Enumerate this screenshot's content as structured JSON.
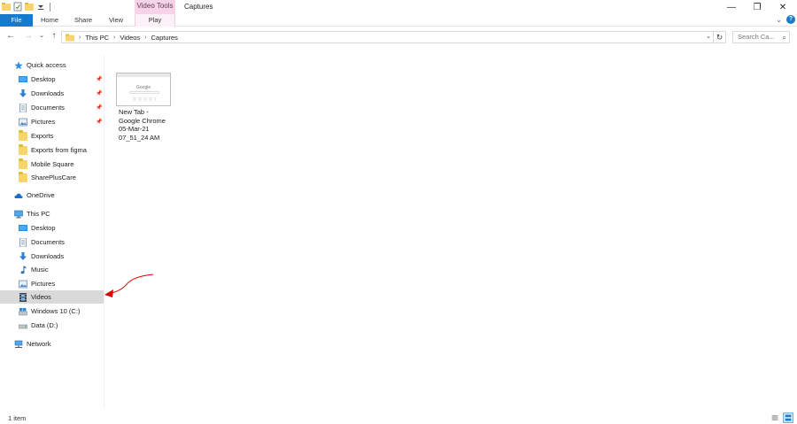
{
  "titlebar": {
    "contextual_tab": "Video Tools",
    "window_title": "Captures",
    "minimize": "—",
    "restore": "❐",
    "close": "✕"
  },
  "ribbon": {
    "tabs": [
      "File",
      "Home",
      "Share",
      "View",
      "Play"
    ],
    "collapse": "⌄",
    "help": "?"
  },
  "address": {
    "back": "←",
    "forward": "→",
    "recent": "⌄",
    "up": "↑",
    "crumbs": [
      "This PC",
      "Videos",
      "Captures"
    ],
    "separator": "›",
    "dropdown": "⌄",
    "refresh": "↻",
    "search_placeholder": "Search Ca...",
    "search_icon": "⌕"
  },
  "nav": {
    "quick_access": "Quick access",
    "quick_items": [
      {
        "label": "Desktop",
        "pinned": true
      },
      {
        "label": "Downloads",
        "pinned": true
      },
      {
        "label": "Documents",
        "pinned": true
      },
      {
        "label": "Pictures",
        "pinned": true
      },
      {
        "label": "Exports",
        "pinned": false
      },
      {
        "label": "Exports from figma",
        "pinned": false
      },
      {
        "label": "Mobile Square",
        "pinned": false
      },
      {
        "label": "SharePlusCare",
        "pinned": false
      }
    ],
    "pin_glyph": "📌",
    "onedrive": "OneDrive",
    "this_pc": "This PC",
    "pc_items": [
      "Desktop",
      "Documents",
      "Downloads",
      "Music",
      "Pictures",
      "Videos",
      "Windows 10 (C:)",
      "Data (D:)"
    ],
    "network": "Network"
  },
  "content": {
    "files": [
      {
        "name": "New Tab -\nGoogle Chrome\n05-Mar-21\n07_51_24 AM",
        "thumb_logo": "Google"
      }
    ]
  },
  "status": {
    "item_count": "1 item"
  },
  "colors": {
    "accent": "#1979ca",
    "contextual": "#f6d3e6",
    "selected": "#d9d9d9",
    "annotation": "#e00000"
  }
}
